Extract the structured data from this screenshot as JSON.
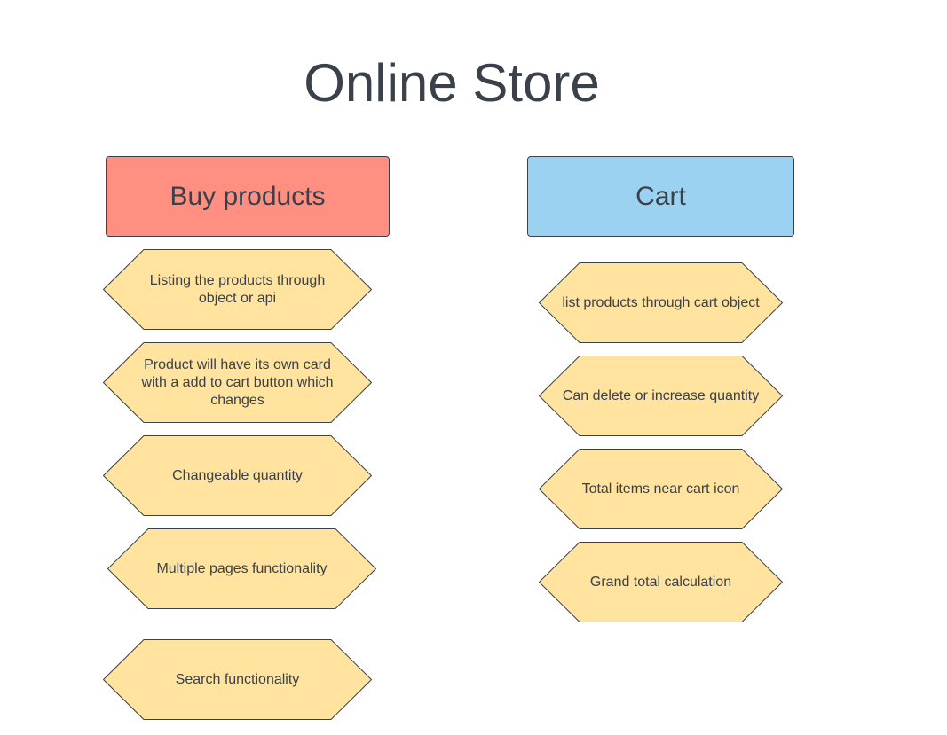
{
  "title": "Online Store",
  "columns": {
    "buy": {
      "header": "Buy products",
      "items": [
        "Listing the products through object or api",
        "Product will have its own card with a add to cart button which changes",
        "Changeable quantity",
        "Multiple pages functionality",
        "Search functionality"
      ]
    },
    "cart": {
      "header": "Cart",
      "items": [
        "list products through cart object",
        "Can delete or increase quantity",
        "Total items near cart icon",
        "Grand total calculation"
      ]
    }
  },
  "colors": {
    "buy_header_fill": "#ff8f80",
    "cart_header_fill": "#9bd2f2",
    "hexagon_fill": "#ffe39e",
    "stroke": "#3a414a",
    "text": "#3a414a"
  }
}
